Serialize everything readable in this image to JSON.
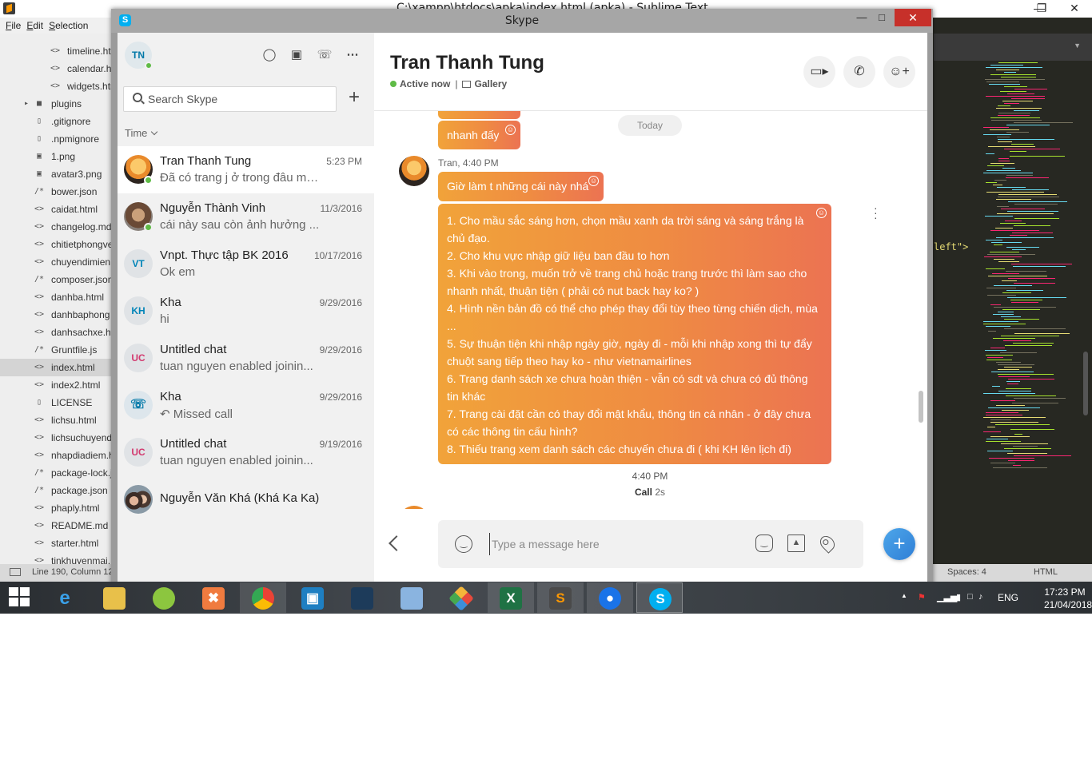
{
  "sublime": {
    "title": "C:\\xampp\\htdocs\\apka\\index.html (apka) - Sublime Text",
    "menu": [
      "File",
      "Edit",
      "Selection"
    ],
    "status_line": "Line 190, Column 12",
    "status_spaces": "Spaces: 4",
    "status_syntax": "HTML",
    "code_snippet": "left\">",
    "files": [
      {
        "icon": "<>",
        "name": "timeline.html"
      },
      {
        "icon": "<>",
        "name": "calendar.html"
      },
      {
        "icon": "<>",
        "name": "widgets.html"
      },
      {
        "icon": "folder",
        "name": "plugins"
      },
      {
        "icon": "file",
        "name": ".gitignore"
      },
      {
        "icon": "file",
        "name": ".npmignore"
      },
      {
        "icon": "img",
        "name": "1.png"
      },
      {
        "icon": "img",
        "name": "avatar3.png"
      },
      {
        "icon": "/*",
        "name": "bower.json"
      },
      {
        "icon": "<>",
        "name": "caidat.html"
      },
      {
        "icon": "<>",
        "name": "changelog.md"
      },
      {
        "icon": "<>",
        "name": "chitietphongve"
      },
      {
        "icon": "<>",
        "name": "chuyendimien"
      },
      {
        "icon": "/*",
        "name": "composer.json"
      },
      {
        "icon": "<>",
        "name": "danhba.html"
      },
      {
        "icon": "<>",
        "name": "danhbaphong"
      },
      {
        "icon": "<>",
        "name": "danhsachxe.html"
      },
      {
        "icon": "/*",
        "name": "Gruntfile.js"
      },
      {
        "icon": "<>",
        "name": "index.html"
      },
      {
        "icon": "<>",
        "name": "index2.html"
      },
      {
        "icon": "file",
        "name": "LICENSE"
      },
      {
        "icon": "<>",
        "name": "lichsu.html"
      },
      {
        "icon": "<>",
        "name": "lichsuchuyend"
      },
      {
        "icon": "<>",
        "name": "nhapdiadiem.h"
      },
      {
        "icon": "/*",
        "name": "package-lock.j"
      },
      {
        "icon": "/*",
        "name": "package.json"
      },
      {
        "icon": "<>",
        "name": "phaply.html"
      },
      {
        "icon": "<>",
        "name": "README.md"
      },
      {
        "icon": "<>",
        "name": "starter.html"
      },
      {
        "icon": "<>",
        "name": "tinkhuyenmai."
      }
    ]
  },
  "skype": {
    "window_title": "Skype",
    "me_initials": "TN",
    "search_placeholder": "Search Skype",
    "sort_label": "Time",
    "conversations": [
      {
        "name": "Tran Thanh Tung",
        "preview": "Đã có trang j ở trong đâu mà ...",
        "time": "5:23 PM"
      },
      {
        "name": "Nguyễn Thành Vinh",
        "preview": "cái này sau còn ảnh hưởng ...",
        "time": "11/3/2016"
      },
      {
        "name": "Vnpt. Thực tập BK 2016",
        "preview": "Ok em",
        "time": "10/17/2016",
        "initials": "VT"
      },
      {
        "name": "Kha",
        "preview": "hi",
        "time": "9/29/2016",
        "initials": "KH"
      },
      {
        "name": "Untitled chat",
        "preview": "tuan nguyen enabled joinin...",
        "time": "9/29/2016",
        "initials": "UC"
      },
      {
        "name": "Kha",
        "preview": "Missed call",
        "time": "9/29/2016"
      },
      {
        "name": "Untitled chat",
        "preview": "tuan nguyen enabled joinin...",
        "time": "9/19/2016",
        "initials": "UC"
      },
      {
        "name": "Nguyễn Văn Khá (Khá Ka Ka)"
      }
    ],
    "chat": {
      "contact_name": "Tran Thanh Tung",
      "status": "Active now",
      "gallery": "Gallery",
      "today": "Today",
      "msg_nhanh": "nhanh đấy",
      "meta": "Tran, 4:40 PM",
      "msg_gio": "Giờ làm t những cái này nhá",
      "list_lines": [
        "1. Cho mầu sắc sáng hơn, chọn mầu xanh da trời sáng và sáng trắng là chủ đạo.",
        "2. Cho khu vực nhập giữ liệu ban đầu to hơn",
        "3. Khi vào trong, muốn trở về trang chủ hoặc trang trước thì làm sao cho nhanh nhất, thuận tiện ( phải có nut back hay ko? )",
        "4. Hình nền bản đồ có thể cho phép thay đổi tùy theo từng chiến dịch, mùa ...",
        "5. Sự thuận tiện khi nhập ngày giờ, ngày đi - mỗi khi nhập xong thì tự đẩy chuột sang tiếp theo hay ko - như vietnamairlines",
        "6. Trang danh sách xe chưa hoàn thiện - vẫn có sdt và chưa có đủ thông tin khác",
        "7. Trang cài đặt cần có thay đổi mật khẩu, thông tin cá nhân - ở đây chưa có các thông tin cấu hình?",
        "8. Thiếu trang xem danh sách các chuyến chưa đi ( khi KH lên lịch đi)"
      ],
      "call_time": "4:40 PM",
      "call_label": "Call",
      "call_duration": "2s",
      "compose_placeholder": "Type a message here"
    }
  },
  "taskbar": {
    "lang": "ENG",
    "time": "17:23 PM",
    "date": "21/04/2018"
  },
  "colors": {
    "bubble_start": "#f1a33a",
    "bubble_end": "#ec7352",
    "presence": "#5fbb46",
    "skype_blue": "#00aff0",
    "close_red": "#c7302a"
  }
}
